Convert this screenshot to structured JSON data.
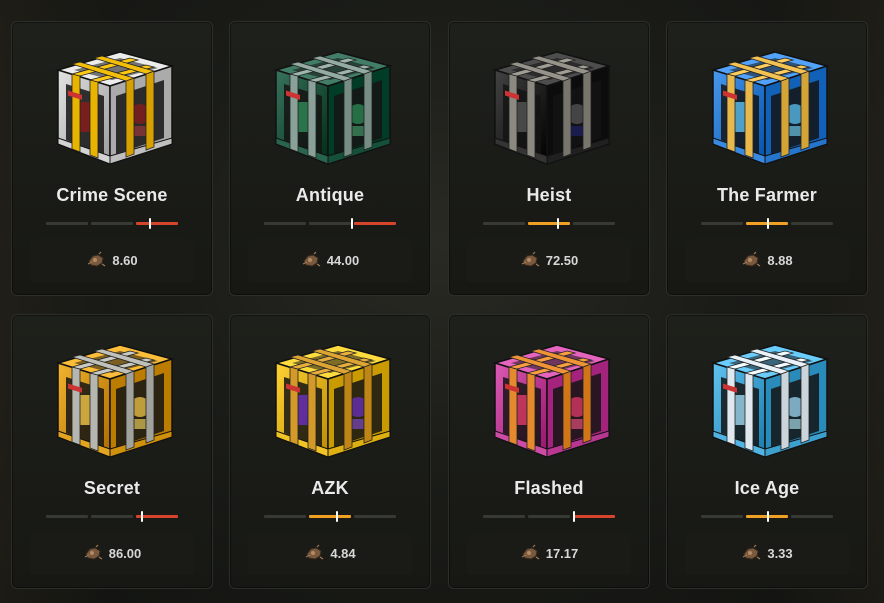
{
  "cases": [
    {
      "name": "Crime Scene",
      "price": "8.60",
      "body": "#c9c9c9",
      "strap": "#e9b400",
      "accent": "#8a1c1c",
      "rarity": "red",
      "level": 0.79
    },
    {
      "name": "Antique",
      "price": "44.00",
      "body": "#1f5a44",
      "strap": "#8aa19a",
      "accent": "#2e8b57",
      "rarity": "red",
      "level": 0.67
    },
    {
      "name": "Heist",
      "price": "72.50",
      "body": "#2a2a2a",
      "strap": "#8c8a80",
      "accent": "#555",
      "rarity": "orange",
      "level": 0.57
    },
    {
      "name": "The Farmer",
      "price": "8.88",
      "body": "#2f7fd6",
      "strap": "#e8b84a",
      "accent": "#5cc1f0",
      "rarity": "orange",
      "level": 0.51
    },
    {
      "name": "Secret",
      "price": "86.00",
      "body": "#d99a16",
      "strap": "#b6b6b0",
      "accent": "#f2c74a",
      "rarity": "red",
      "level": 0.73
    },
    {
      "name": "AZK",
      "price": "4.84",
      "body": "#e8b91b",
      "strap": "#d39a2a",
      "accent": "#6b2fbf",
      "rarity": "orange",
      "level": 0.55
    },
    {
      "name": "Flashed",
      "price": "17.17",
      "body": "#c2419a",
      "strap": "#e48a2c",
      "accent": "#e13b6a",
      "rarity": "red",
      "level": 0.69
    },
    {
      "name": "Ice Age",
      "price": "3.33",
      "body": "#47a9d8",
      "strap": "#dfe8ee",
      "accent": "#9fd8f3",
      "rarity": "orange",
      "level": 0.51
    }
  ],
  "colors": {
    "red": "#d7442c",
    "orange": "#f0a023",
    "track": "#373a33"
  },
  "icons": {
    "price": "scrap-coin-icon"
  }
}
